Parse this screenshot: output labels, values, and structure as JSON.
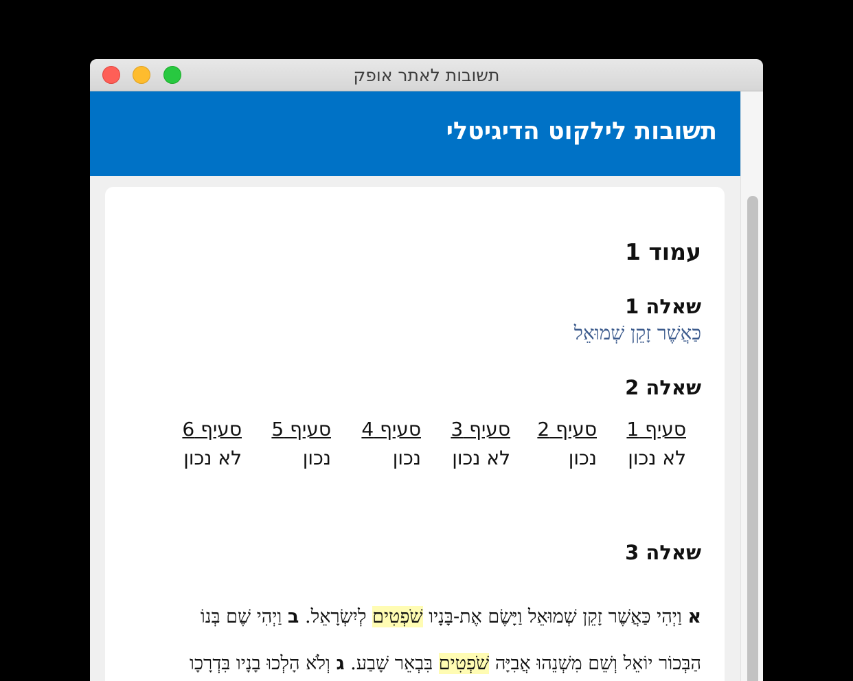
{
  "window": {
    "title": "תשובות לאתר אופק"
  },
  "header": {
    "title": "תשובות לילקוט הדיגיטלי"
  },
  "page": {
    "heading": "עמוד 1"
  },
  "question1": {
    "label": "שאלה 1",
    "answer": "כַּאֲשֶׁר זָקֵן שְׁמוּאֵל"
  },
  "question2": {
    "label": "שאלה 2",
    "sections": [
      {
        "label": "סעיף 1",
        "value": "לא נכון"
      },
      {
        "label": "סעיף 2",
        "value": "נכון"
      },
      {
        "label": "סעיף 3",
        "value": "לא נכון"
      },
      {
        "label": "סעיף 4",
        "value": "נכון"
      },
      {
        "label": "סעיף 5",
        "value": "נכון"
      },
      {
        "label": "סעיף 6",
        "value": "לא נכון"
      }
    ]
  },
  "question3": {
    "label": "שאלה 3",
    "line1": {
      "mark_a": "א",
      "part1": "וַיְהִי כַּאֲשֶׁר זָקֵן שְׁמוּאֵל וַיָּשֶׂם אֶת-בָּנָיו",
      "highlight": "שֹׁפְטִים",
      "part2": "לְיִשְׂרָאֵל.",
      "mark_b": "ב",
      "part3": "וַיְהִי שֶׁם בְּנוֹ"
    },
    "line2": {
      "part1": "הַבְּכוֹר יוֹאֵל וְשֵׁם מִשְׁנֵהוּ אֲבִיָּה",
      "highlight": "שֹׁפְטִים",
      "part2": "בִּבְאֵר שָׁבַע.",
      "mark_g": "ג",
      "part3": "וְלֹא הָלְכוּ בָנָיו בִּדְרָכָו"
    }
  },
  "colors": {
    "header_bg": "#0072c6",
    "answer_text": "#3b5a8c",
    "highlight": "#fffcb3"
  }
}
